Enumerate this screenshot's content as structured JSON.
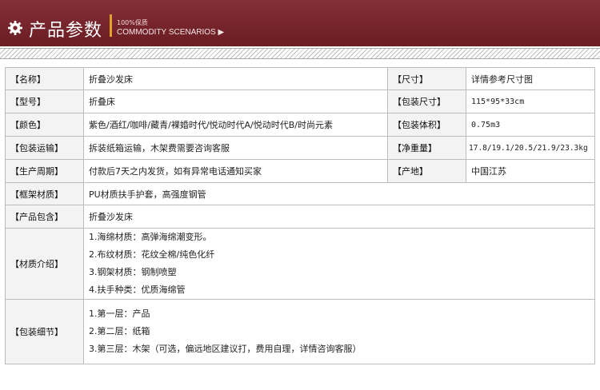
{
  "header": {
    "title": "产品参数",
    "percent_text": "100%保质",
    "subtitle": "COMMODITY SCENARIOS ▶"
  },
  "params": {
    "name_label": "【名称】",
    "name_value": "折叠沙发床",
    "size_label": "【尺寸】",
    "size_value": "详情参考尺寸图",
    "model_label": "【型号】",
    "model_value": "折叠床",
    "pack_size_label": "【包装尺寸】",
    "pack_size_value": "115*95*33cm",
    "color_label": "【颜色】",
    "color_value": "紫色/酒红/咖啡/藏青/裸婚时代/悦动时代A/悦动时代B/时尚元素",
    "pack_volume_label": "【包装体积】",
    "pack_volume_value": "0.75m3",
    "shipping_label": "【包装运输】",
    "shipping_value": "拆装纸箱运输，木架费需要咨询客服",
    "net_weight_label": "【净重量】",
    "net_weight_value": "17.8/19.1/20.5/21.9/23.3kg",
    "cycle_label": "【生产周期】",
    "cycle_value": "付款后7天之内发货，如有异常电话通知买家",
    "origin_label": "【产地】",
    "origin_value": "中国江苏",
    "frame_label": "【框架材质】",
    "frame_value": "PU材质扶手护套，高强度钢管",
    "contents_label": "【产品包含】",
    "contents_value": "折叠沙发床",
    "material_label": "【材质介绍】",
    "material_lines": [
      "1.海绵材质：高弹海绵潮变形。",
      "2.布纹材质：花纹全棉/纯色化纤",
      "3.钢架材质：钢制喷塑",
      "4.扶手种类：优质海绵管"
    ],
    "packing_label": "【包装细节】",
    "packing_lines": [
      "1.第一层：产品",
      "2.第二层：纸箱",
      "3.第三层：木架（可选，偏远地区建议打，费用自理，详情咨询客服）"
    ]
  }
}
